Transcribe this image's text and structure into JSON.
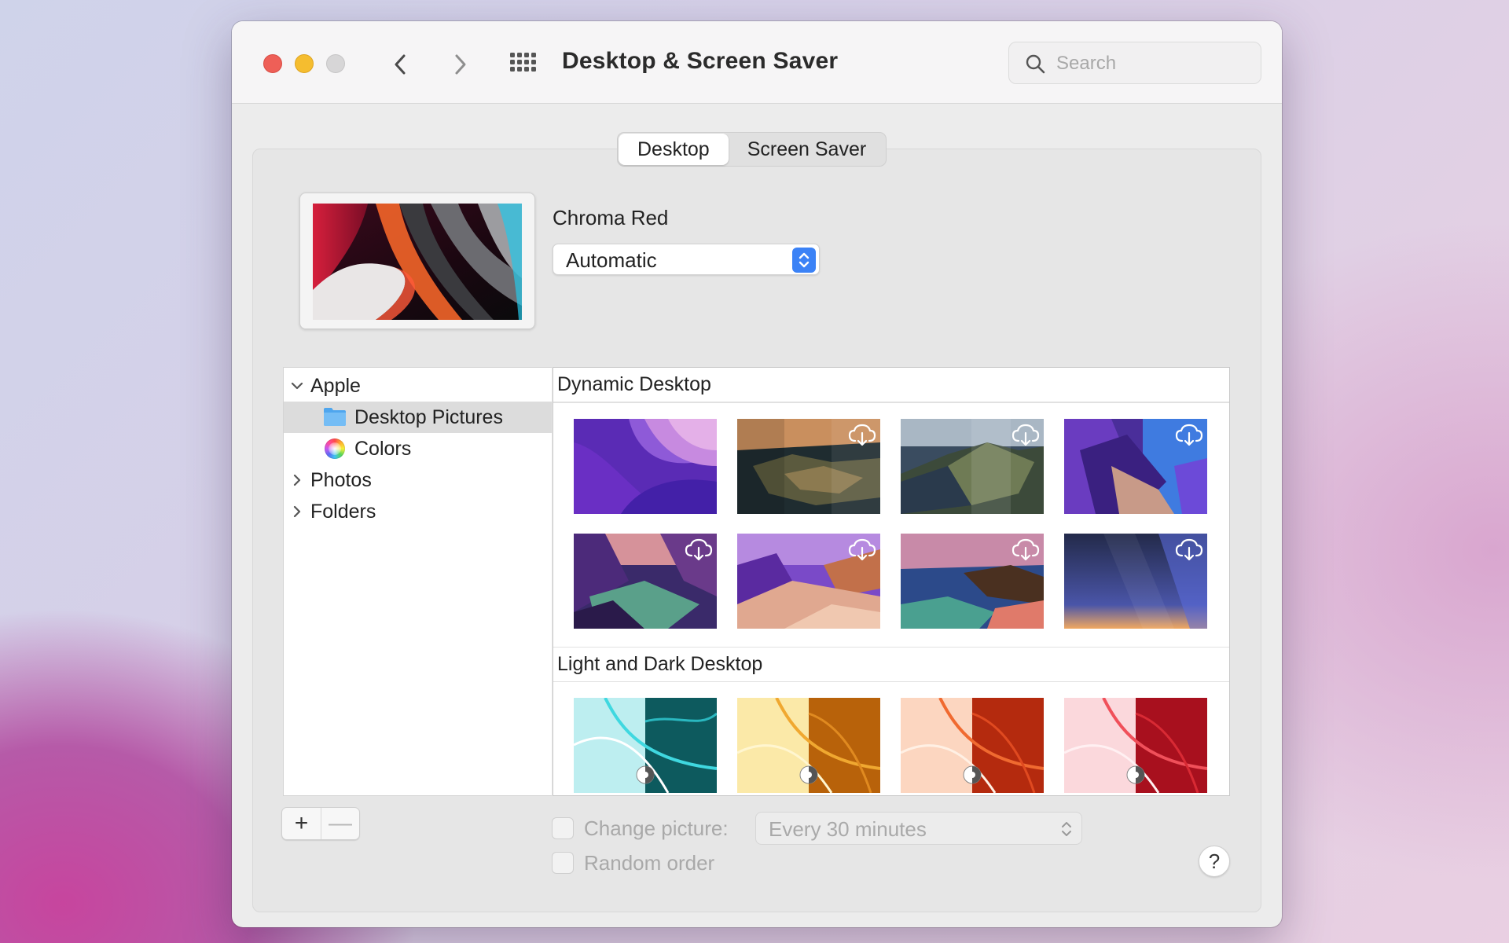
{
  "window": {
    "title": "Desktop & Screen Saver"
  },
  "search": {
    "placeholder": "Search"
  },
  "tabs": [
    {
      "label": "Desktop",
      "active": true
    },
    {
      "label": "Screen Saver",
      "active": false
    }
  ],
  "current": {
    "wallpaper_name": "Chroma Red",
    "mode_value": "Automatic"
  },
  "sidebar": {
    "apple": "Apple",
    "desktop_pictures": "Desktop Pictures",
    "colors": "Colors",
    "photos": "Photos",
    "folders": "Folders"
  },
  "sections": {
    "dynamic": "Dynamic Desktop",
    "light_dark": "Light and Dark Desktop"
  },
  "controls": {
    "add": "+",
    "remove": "—",
    "change_picture": "Change picture:",
    "interval": "Every 30 minutes",
    "random_order": "Random order",
    "help": "?"
  },
  "colors": {
    "accent": "#3b82f6",
    "close": "#ee5f57",
    "minimize": "#f5bd2f"
  },
  "icons": [
    "chevron-left-icon",
    "chevron-right-icon",
    "grid-icon",
    "search-icon",
    "folder-icon",
    "color-wheel-icon",
    "cloud-download-icon",
    "light-dark-icon",
    "help-icon"
  ]
}
